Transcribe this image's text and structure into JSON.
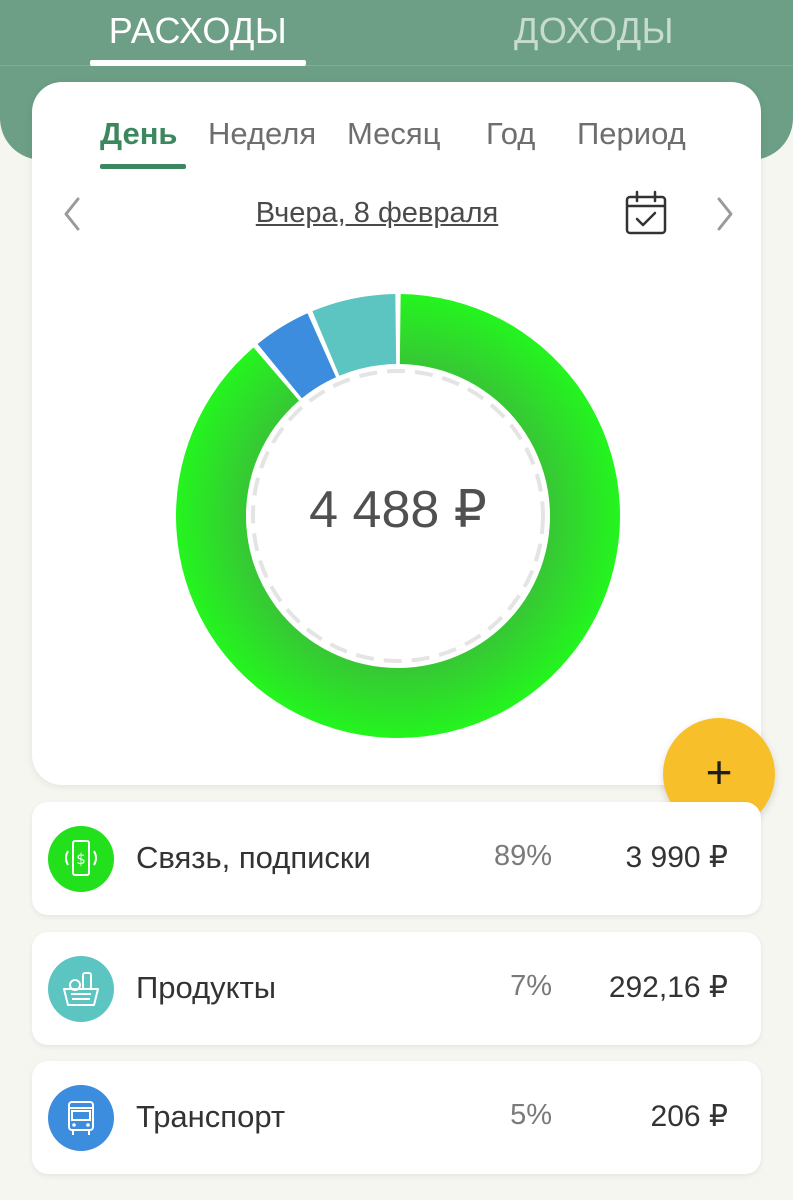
{
  "top_tabs": [
    {
      "label": "РАСХОДЫ",
      "active": true
    },
    {
      "label": "ДОХОДЫ",
      "active": false
    }
  ],
  "period_tabs": [
    {
      "label": "День",
      "active": true
    },
    {
      "label": "Неделя",
      "active": false
    },
    {
      "label": "Месяц",
      "active": false
    },
    {
      "label": "Год",
      "active": false
    },
    {
      "label": "Период",
      "active": false
    }
  ],
  "date_nav": {
    "date_label": "Вчера, 8 февраля",
    "prev_icon": "chevron-left-icon",
    "next_icon": "chevron-right-icon",
    "calendar_icon": "calendar-check-icon"
  },
  "summary": {
    "total": "4 488 ₽"
  },
  "fab": {
    "label": "+"
  },
  "categories": [
    {
      "name": "Связь, подписки",
      "percent": "89%",
      "amount": "3 990 ₽",
      "share": 89,
      "color": "#22e01c",
      "icon": "phone-money-icon"
    },
    {
      "name": "Продукты",
      "percent": "7%",
      "amount": "292,16 ₽",
      "share": 6.5,
      "color": "#5cc4c1",
      "icon": "grocery-basket-icon"
    },
    {
      "name": "Транспорт",
      "percent": "5%",
      "amount": "206 ₽",
      "share": 4.6,
      "color": "#3c8ddd",
      "icon": "bus-icon"
    }
  ],
  "colors": {
    "header": "#6c9f86",
    "accent": "#3d8760",
    "fab": "#f7c02a"
  }
}
